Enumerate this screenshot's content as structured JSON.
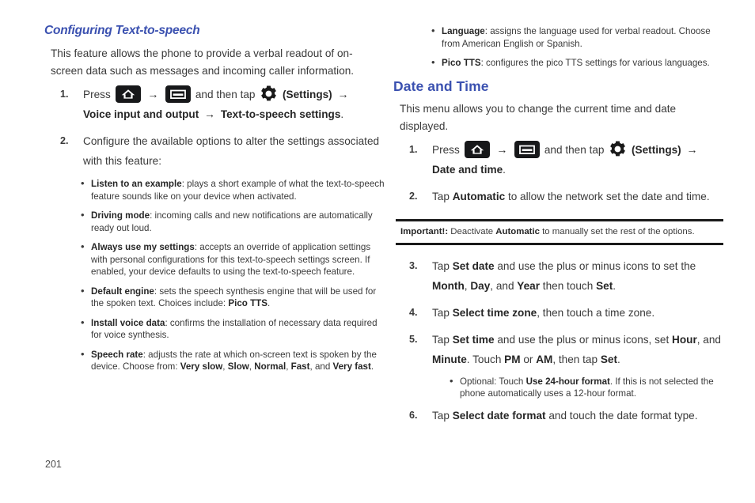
{
  "page": {
    "number": "201",
    "heading_color": "#3b51b0",
    "body_color": "#3a3a3a"
  },
  "left_column": {
    "heading": "Configuring Text-to-speech",
    "intro": "This feature allows the phone to provide a verbal readout of on-screen data such as messages and incoming caller information.",
    "steps": [
      {
        "num": "1.",
        "pre_icons": "Press",
        "icon_home": "home-icon",
        "arrow1": "→",
        "icon_menu": "menu-icon",
        "mid": "and then tap",
        "icon_gear": "gear-icon",
        "settings_label": "(Settings)",
        "arrow2": "→",
        "bold_path_1": "Voice input and output",
        "arrow3": "→",
        "bold_path_2": "Text-to-speech settings",
        "period": "."
      },
      {
        "num": "2.",
        "text": "Configure the available options to alter the settings associated with this feature:"
      }
    ],
    "bullets": [
      {
        "term": "Listen to an example",
        "text": ": plays a short example of what the text-to-speech feature sounds like on your device when activated."
      },
      {
        "term": "Driving mode",
        "text": ": incoming calls and new notifications are automatically ready out loud."
      },
      {
        "term": "Always use my settings",
        "text": ": accepts an override of application settings with personal configurations for this text-to-speech settings screen. If enabled, your device defaults to using the text-to-speech feature."
      },
      {
        "term": "Default engine",
        "text": ": sets the speech synthesis engine that will be used for the spoken text. Choices include: ",
        "term_end": "Pico TTS",
        "text_end": "."
      },
      {
        "term": "Install voice data",
        "text": ": confirms the installation of necessary data required for voice synthesis."
      },
      {
        "term": "Speech rate",
        "text": ": adjusts the rate at which on-screen text is spoken by the device. Choose from: ",
        "options": [
          "Very slow",
          "Slow",
          "Normal",
          "Fast",
          "Very fast"
        ],
        "text_end": "."
      }
    ]
  },
  "right_column": {
    "top_bullets": [
      {
        "term": "Language",
        "text": ": assigns the language used for verbal readout. Choose from American English or Spanish."
      },
      {
        "term": "Pico TTS",
        "text": ": configures the pico TTS settings for various languages."
      }
    ],
    "heading": "Date and Time",
    "intro": "This menu allows you to change the current time and date displayed.",
    "steps_before": [
      {
        "num": "1.",
        "pre_icons": "Press",
        "icon_home": "home-icon",
        "arrow1": "→",
        "icon_menu": "menu-icon",
        "mid": "and then tap",
        "icon_gear": "gear-icon",
        "settings_label": "(Settings)",
        "arrow2": "→",
        "bold_path_1": "Date and time",
        "period": "."
      },
      {
        "num": "2.",
        "pre": "Tap ",
        "bold": "Automatic",
        "post": " to allow the network set the date and time."
      }
    ],
    "important": {
      "label": "Important!:",
      "pre": " Deactivate ",
      "bold": "Automatic",
      "post": " to manually set the rest of the options."
    },
    "steps_after": [
      {
        "num": "3.",
        "pre": "Tap ",
        "bold1": "Set date",
        "mid1": " and use the plus or minus icons to set the ",
        "bold2": "Month",
        "mid2": ", ",
        "bold3": "Day",
        "mid3": ", and ",
        "bold4": "Year",
        "mid4": " then touch ",
        "bold5": "Set",
        "post": "."
      },
      {
        "num": "4.",
        "pre": "Tap ",
        "bold1": "Select time zone",
        "post": ", then touch a time zone."
      },
      {
        "num": "5.",
        "pre": "Tap ",
        "bold1": "Set time",
        "mid1": " and use the plus or minus icons, set ",
        "bold2": "Hour",
        "mid2": ", and ",
        "bold3": "Minute",
        "mid3": ". Touch ",
        "bold4": "PM",
        "mid4": " or ",
        "bold5": "AM",
        "mid5": ", then tap ",
        "bold6": "Set",
        "post": ".",
        "sub_bullet": {
          "pre": "Optional: Touch ",
          "bold": "Use 24-hour format",
          "post": ". If this is not selected the phone automatically uses a 12-hour format."
        }
      },
      {
        "num": "6.",
        "pre": "Tap ",
        "bold1": "Select date format",
        "post": " and touch the date format type."
      }
    ]
  }
}
